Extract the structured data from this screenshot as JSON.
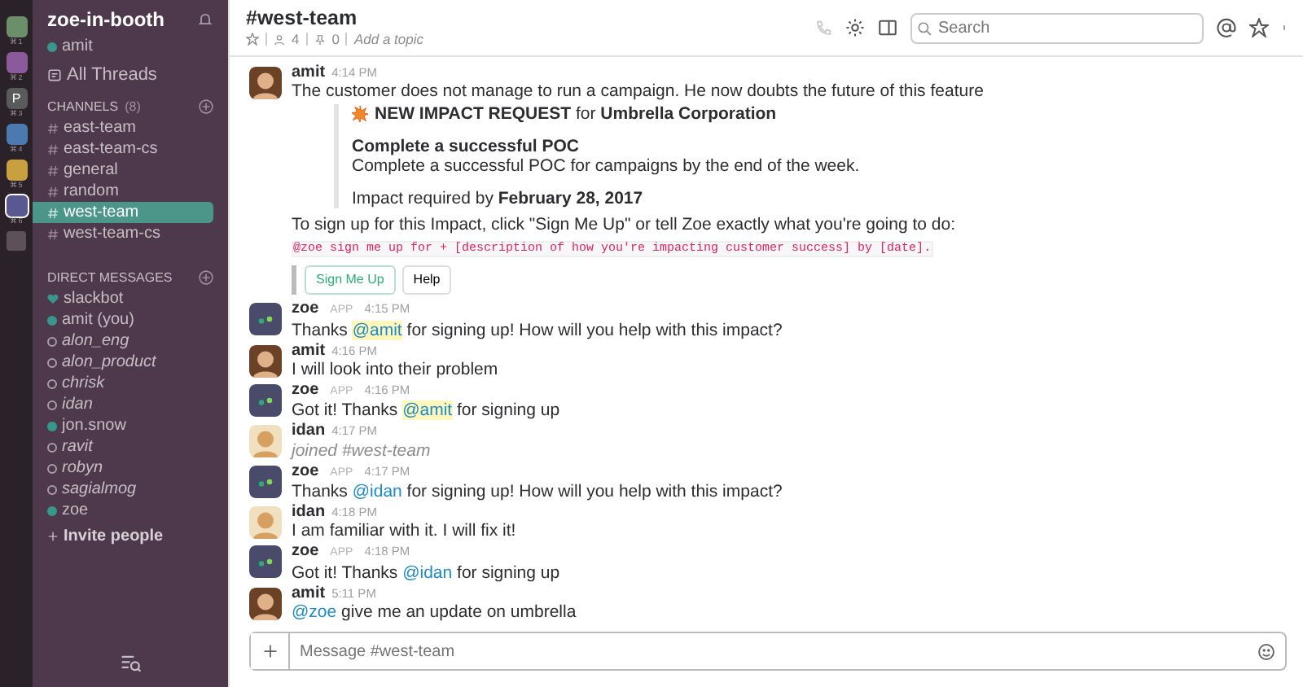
{
  "teams": [
    {
      "shortcut": "⌘1",
      "color": "#6a8f6a",
      "selected": false
    },
    {
      "shortcut": "⌘2",
      "color": "#8a5a9a",
      "selected": false
    },
    {
      "shortcut": "⌘3",
      "color": "#5a5a5a",
      "selected": false,
      "letter": "P"
    },
    {
      "shortcut": "⌘4",
      "color": "#4a7ab0",
      "selected": false
    },
    {
      "shortcut": "⌘5",
      "color": "#c8a040",
      "selected": false
    },
    {
      "shortcut": "⌘6",
      "color": "#5a5890",
      "selected": true
    }
  ],
  "sidebar": {
    "team_name": "zoe-in-booth",
    "user": "amit",
    "all_threads": "All Threads",
    "channels_heading": "CHANNELS",
    "channels_count": "(8)",
    "channels": [
      {
        "label": "east-team",
        "selected": false
      },
      {
        "label": "east-team-cs",
        "selected": false
      },
      {
        "label": "general",
        "selected": false
      },
      {
        "label": "random",
        "selected": false
      },
      {
        "label": "west-team",
        "selected": true
      },
      {
        "label": "west-team-cs",
        "selected": false
      }
    ],
    "dm_heading": "DIRECT MESSAGES",
    "direct_messages": [
      {
        "label": "slackbot",
        "kind": "bot"
      },
      {
        "label": "amit (you)",
        "kind": "online"
      },
      {
        "label": "alon_eng",
        "kind": "away"
      },
      {
        "label": "alon_product",
        "kind": "away"
      },
      {
        "label": "chrisk",
        "kind": "away"
      },
      {
        "label": "idan",
        "kind": "away"
      },
      {
        "label": "jon.snow",
        "kind": "online"
      },
      {
        "label": "ravit",
        "kind": "away"
      },
      {
        "label": "robyn",
        "kind": "away"
      },
      {
        "label": "sagialmog",
        "kind": "away"
      },
      {
        "label": "zoe",
        "kind": "online"
      }
    ],
    "invite": "Invite people"
  },
  "header": {
    "channel": "#west-team",
    "members": "4",
    "pins": "0",
    "topic": "Add a topic",
    "search_placeholder": "Search"
  },
  "messages": [
    {
      "author": "amit",
      "avatar": {
        "kind": "person"
      },
      "time": "4:14 PM",
      "kind": "text",
      "parts": [
        {
          "kind": "text",
          "text": "The customer does not manage to run a campaign. He now doubts the future of this feature"
        }
      ]
    },
    {
      "kind": "impact",
      "title": "**NEW IMPACT REQUEST** for **Umbrella Corporation**",
      "goal": "Complete a successful POC",
      "description": "Complete a successful POC for campaigns by the end of the week.",
      "deadline": "Impact required by **February 28, 2017**",
      "instructions": "To sign up for this Impact, click \"Sign Me Up\" or tell Zoe exactly what you're going to do:",
      "command": "@zoe sign me up for + [description of how you're impacting customer success] by [date].",
      "buttons": [
        {
          "label": "Sign Me Up",
          "kind": "primary"
        },
        {
          "label": "Help",
          "kind": "plain"
        }
      ]
    },
    {
      "author": "zoe",
      "avatar": {
        "kind": "bot"
      },
      "badge": "APP",
      "time": "4:15 PM",
      "kind": "text",
      "parts": [
        {
          "kind": "text",
          "text": "Thanks"
        },
        {
          "kind": "mention",
          "text": "@amit",
          "highlight": true
        },
        {
          "kind": "text",
          "text": "for signing up! How will you help with this impact?"
        }
      ]
    },
    {
      "author": "amit",
      "avatar": {
        "kind": "person"
      },
      "time": "4:16 PM",
      "kind": "text",
      "parts": [
        {
          "kind": "text",
          "text": "I will look into their problem"
        }
      ]
    },
    {
      "author": "zoe",
      "avatar": {
        "kind": "bot"
      },
      "badge": "APP",
      "time": "4:16 PM",
      "kind": "text",
      "parts": [
        {
          "kind": "text",
          "text": "Got it! Thanks"
        },
        {
          "kind": "mention",
          "text": "@amit",
          "highlight": true
        },
        {
          "kind": "text",
          "text": "for signing up"
        }
      ]
    },
    {
      "author": "idan",
      "avatar": {
        "kind": "person2"
      },
      "time": "4:17 PM",
      "kind": "joined",
      "parts": [
        {
          "kind": "text",
          "text": "joined #west-team"
        }
      ]
    },
    {
      "author": "zoe",
      "avatar": {
        "kind": "bot"
      },
      "badge": "APP",
      "time": "4:17 PM",
      "kind": "text",
      "parts": [
        {
          "kind": "text",
          "text": "Thanks"
        },
        {
          "kind": "mention",
          "text": "@idan",
          "highlight": false
        },
        {
          "kind": "text",
          "text": "for signing up! How will you help with this impact?"
        }
      ]
    },
    {
      "author": "idan",
      "avatar": {
        "kind": "person2"
      },
      "time": "4:18 PM",
      "kind": "text",
      "parts": [
        {
          "kind": "text",
          "text": "I am familiar with it. I will fix it!"
        }
      ]
    },
    {
      "author": "zoe",
      "avatar": {
        "kind": "bot"
      },
      "badge": "APP",
      "time": "4:18 PM",
      "kind": "text",
      "parts": [
        {
          "kind": "text",
          "text": "Got it! Thanks"
        },
        {
          "kind": "mention",
          "text": "@idan",
          "highlight": false
        },
        {
          "kind": "text",
          "text": "for signing up"
        }
      ]
    },
    {
      "author": "amit",
      "avatar": {
        "kind": "person"
      },
      "time": "5:11 PM",
      "kind": "text",
      "parts": [
        {
          "kind": "mention",
          "text": "@zoe",
          "highlight": false
        },
        {
          "kind": "text",
          "text": "give me an update on umbrella"
        }
      ]
    }
  ],
  "composer": {
    "placeholder": "Message #west-team"
  }
}
